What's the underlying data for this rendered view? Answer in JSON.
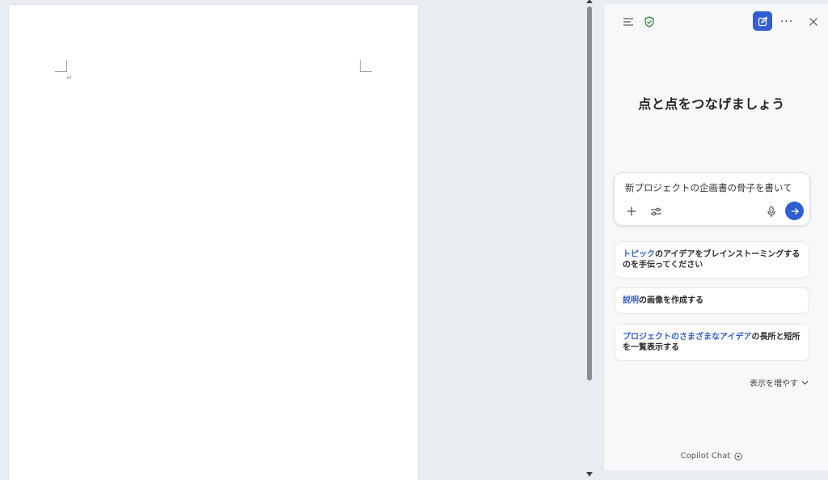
{
  "document": {
    "paragraph_mark": "↵"
  },
  "copilot": {
    "greeting": "点と点をつなげましょう",
    "input": {
      "text": "新プロジェクトの企画書の骨子を書いて"
    },
    "suggestions": [
      {
        "highlight": "トピック",
        "rest": "のアイデアをブレインストーミングするのを手伝ってください"
      },
      {
        "highlight": "説明",
        "rest": "の画像を作成する"
      },
      {
        "highlight": "プロジェクトのさまざまなアイデア",
        "rest": "の長所と短所を一覧表示する"
      }
    ],
    "show_more": "表示を増やす",
    "footer": "Copilot Chat"
  },
  "colors": {
    "accent": "#2f5fd0",
    "shield": "#2e8b3d"
  },
  "icons": {
    "menu": "menu-icon",
    "shield": "shield-check-icon",
    "new_chat": "compose-icon",
    "more": "more-icon",
    "close": "close-icon",
    "add": "plus-icon",
    "settings": "sliders-icon",
    "mic": "microphone-icon",
    "send": "arrow-right-icon",
    "chevron": "chevron-down-icon",
    "info": "info-icon"
  }
}
